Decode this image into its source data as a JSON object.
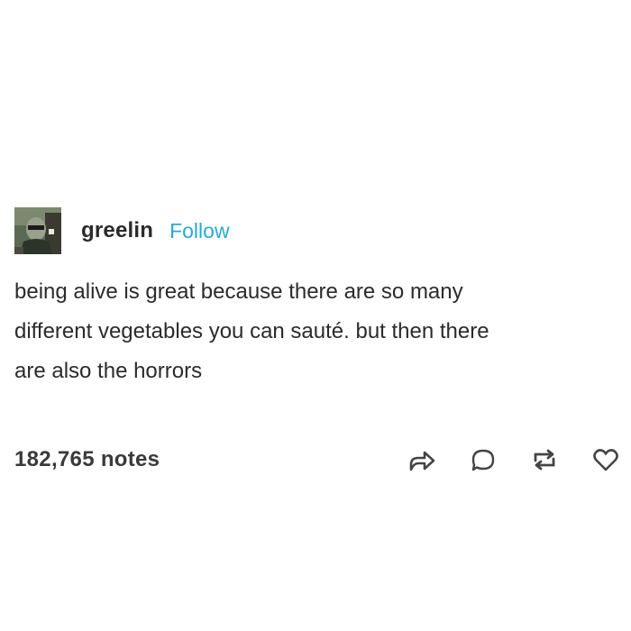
{
  "post": {
    "username": "greelin",
    "follow_label": "Follow",
    "body_lines": [
      "being alive is great because there are so many",
      "different vegetables you can sauté.  but then there",
      "are also the horrors"
    ],
    "notes": "182,765 notes"
  },
  "icons": {
    "share": "share-arrow-icon",
    "reply": "reply-bubble-icon",
    "reblog": "reblog-icon",
    "like": "heart-icon"
  },
  "colors": {
    "follow": "#29a9d6",
    "text": "#2b2b2b",
    "icons": "#444444"
  }
}
